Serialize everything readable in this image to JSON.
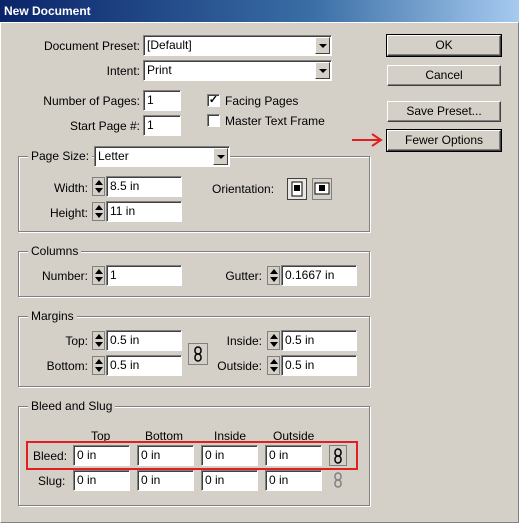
{
  "window": {
    "title": "New Document"
  },
  "document_preset": {
    "label": "Document Preset:",
    "value": "[Default]"
  },
  "intent": {
    "label": "Intent:",
    "value": "Print"
  },
  "number_of_pages": {
    "label": "Number of Pages:",
    "value": "1"
  },
  "start_page": {
    "label": "Start Page #:",
    "value": "1"
  },
  "facing_pages": {
    "label": "Facing Pages",
    "checked": true
  },
  "master_text_frame": {
    "label": "Master Text Frame",
    "checked": false
  },
  "buttons": {
    "ok": "OK",
    "cancel": "Cancel",
    "save_preset": "Save Preset...",
    "fewer_options": "Fewer Options"
  },
  "page_size": {
    "label": "Page Size:",
    "value": "Letter",
    "width_label": "Width:",
    "width": "8.5 in",
    "height_label": "Height:",
    "height": "11 in",
    "orientation_label": "Orientation:"
  },
  "columns": {
    "title": "Columns",
    "number_label": "Number:",
    "number": "1",
    "gutter_label": "Gutter:",
    "gutter": "0.1667 in"
  },
  "margins": {
    "title": "Margins",
    "top_label": "Top:",
    "top": "0.5 in",
    "bottom_label": "Bottom:",
    "bottom": "0.5 in",
    "inside_label": "Inside:",
    "inside": "0.5 in",
    "outside_label": "Outside:",
    "outside": "0.5 in"
  },
  "bleed_slug": {
    "title": "Bleed and Slug",
    "columns": [
      "Top",
      "Bottom",
      "Inside",
      "Outside"
    ],
    "bleed_label": "Bleed:",
    "bleed": [
      "0 in",
      "0 in",
      "0 in",
      "0 in"
    ],
    "slug_label": "Slug:",
    "slug": [
      "0 in",
      "0 in",
      "0 in",
      "0 in"
    ]
  },
  "colors": {
    "highlight": "#e02020",
    "title_bar": "#0a246a",
    "face": "#d4d0c8"
  }
}
